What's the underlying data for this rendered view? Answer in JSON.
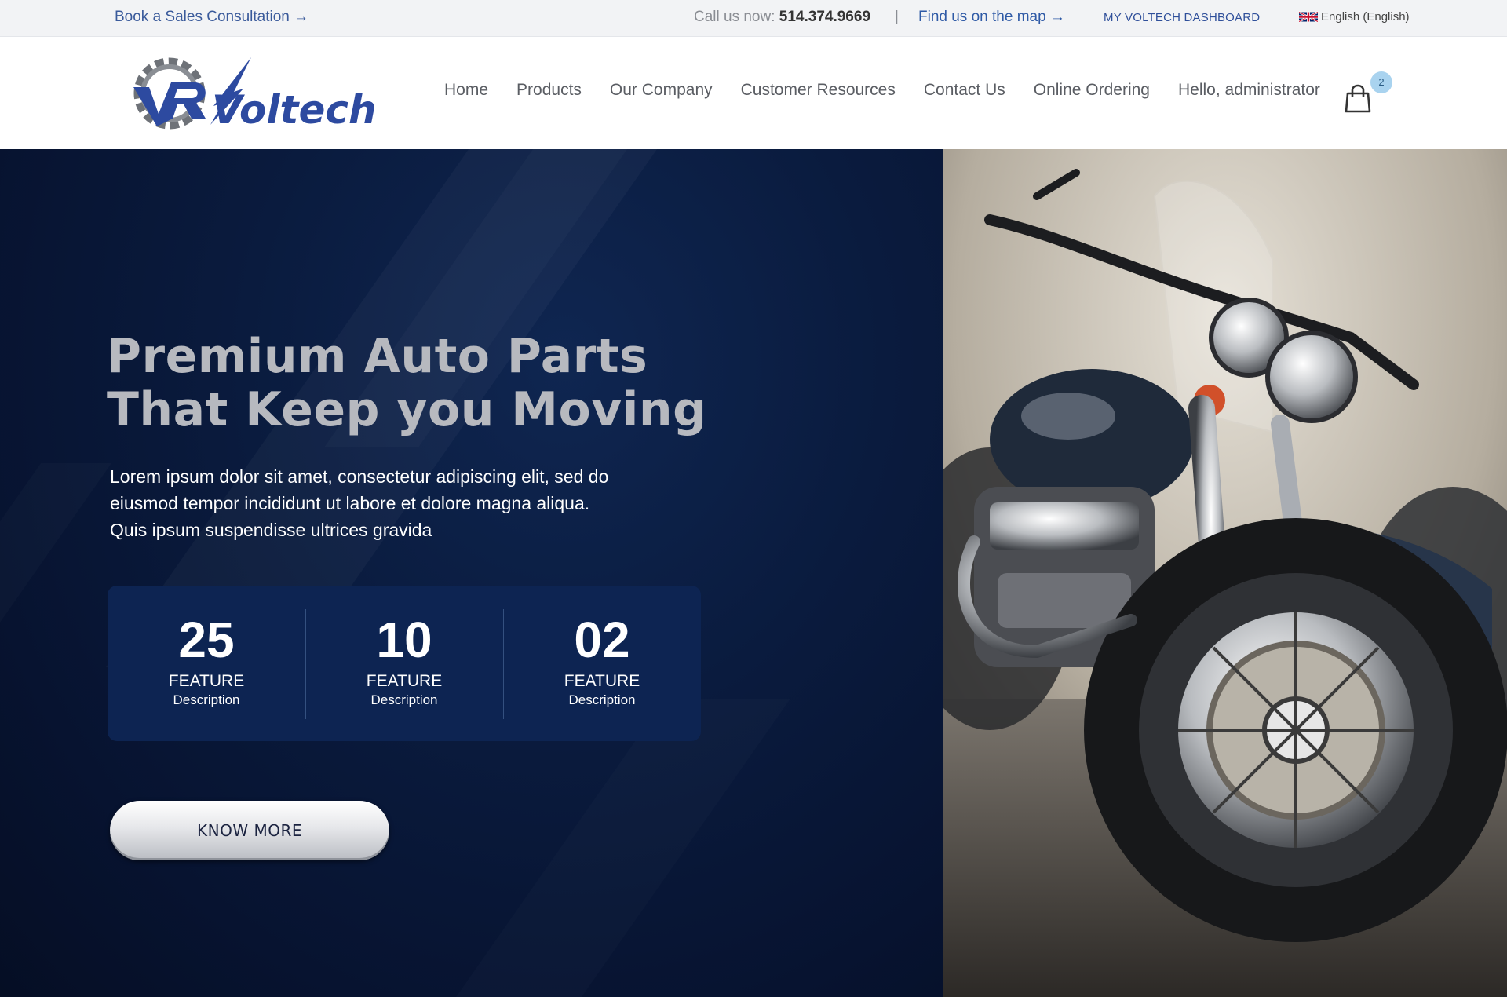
{
  "topbar": {
    "book_link": "Book a Sales Consultation →",
    "call_label": "Call us now:",
    "call_number": "514.374.9669",
    "separator": "|",
    "map_link": "Find us on the map →",
    "dashboard_link": "MY VOLTECH DASHBOARD",
    "language": "English (English)"
  },
  "brand": {
    "name": "Voltech"
  },
  "nav": {
    "items": [
      "Home",
      "Products",
      "Our Company",
      "Customer Resources",
      "Contact Us",
      "Online Ordering",
      "Hello, administrator"
    ],
    "cart_count": "2"
  },
  "hero": {
    "title_line1": "Premium Auto Parts",
    "title_line2": "That Keep you Moving",
    "lead_line1": "Lorem ipsum dolor sit amet, consectetur adipiscing elit, sed do",
    "lead_line2": "eiusmod tempor incididunt ut labore et dolore magna aliqua.",
    "lead_line3": "Quis ipsum suspendisse ultrices gravida",
    "stats": [
      {
        "number": "25",
        "label": "FEATURE",
        "desc": "Description"
      },
      {
        "number": "10",
        "label": "FEATURE",
        "desc": "Description"
      },
      {
        "number": "02",
        "label": "FEATURE",
        "desc": "Description"
      }
    ],
    "cta": "KNOW MORE"
  },
  "colors": {
    "brand_blue": "#2f4f9a",
    "hero_bg": "#0a1b3e",
    "stats_bg": "#0d2452",
    "badge": "#a9d3ef"
  }
}
